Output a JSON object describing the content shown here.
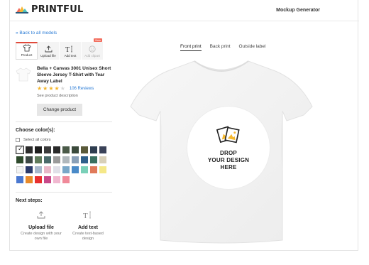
{
  "header": {
    "logo_text": "PRINTFUL",
    "title": "Mockup Generator"
  },
  "nav": {
    "back_label": "« Back to all models"
  },
  "toolbar": {
    "product_label": "Product",
    "upload_label": "Upload file",
    "text_label": "Add text",
    "clipart_label": "Add clipart",
    "clipart_badge": "New"
  },
  "product": {
    "title": "Bella + Canvas 3001 Unisex Short Sleeve Jersey T-Shirt with Tear Away Label",
    "rating": 4,
    "reviews": "106 Reviews",
    "description_link": "See product description",
    "change_button": "Change product"
  },
  "colors": {
    "title": "Choose color(s):",
    "select_all": "Select all colors",
    "selected_index": 0,
    "swatches": [
      "#ffffff",
      "#2b2b2b",
      "#1e1e1e",
      "#3a3a3a",
      "#2a2a2a",
      "#4a5a48",
      "#3b4a3c",
      "#5a5a3a",
      "#2f3e50",
      "#3a4258",
      "#2e4a2c",
      "#3d4844",
      "#5f7b5b",
      "#4a6a6a",
      "#9a9a9a",
      "#b0b8bc",
      "#8aa0b8",
      "#2e5f8a",
      "#3a7060",
      "#d8d0b8",
      "#f2f2f2",
      "#2b3a6a",
      "#a8b8cc",
      "#e8b8c8",
      "#e0e0e8",
      "#7aa8c8",
      "#4a8ac8",
      "#7ad0b8",
      "#e07a5a",
      "#f5e888",
      "#4a78d0",
      "#e88a2a",
      "#e83030",
      "#c84a8a",
      "#f0b8d0",
      "#f08a9a"
    ]
  },
  "next_steps": {
    "title": "Next steps:",
    "upload_title": "Upload file",
    "upload_sub": "Create design with your own file",
    "text_title": "Add text",
    "text_sub": "Create text-based design"
  },
  "tabs": [
    "Front print",
    "Back print",
    "Outside label"
  ],
  "drop_zone": {
    "line1": "DROP",
    "line2": "YOUR DESIGN",
    "line3": "HERE"
  }
}
